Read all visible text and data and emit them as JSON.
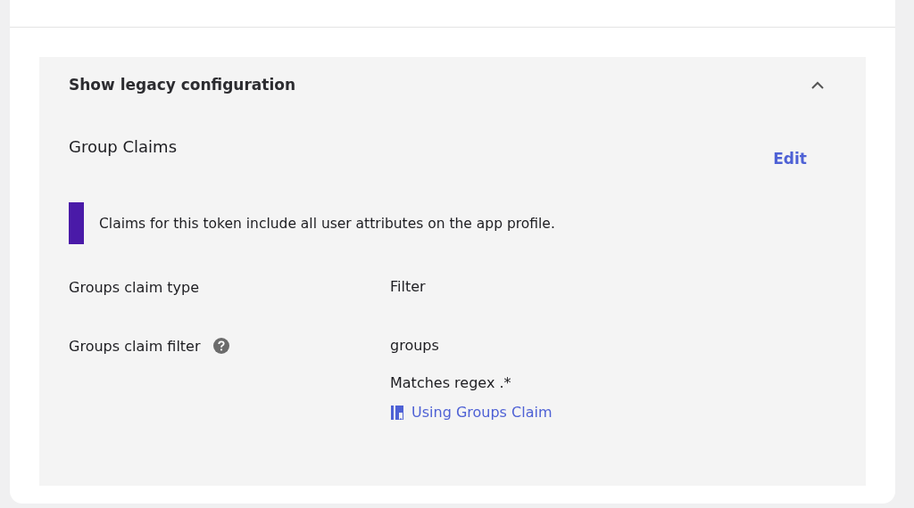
{
  "panel": {
    "title": "Show legacy configuration",
    "expanded": true,
    "section": {
      "title": "Group Claims",
      "edit_label": "Edit"
    },
    "notice": {
      "text": "Claims for this token include all user attributes on the app profile.",
      "color": "#4a1aa8"
    },
    "fields": [
      {
        "label": "Groups claim type",
        "help": false,
        "values": [
          "Filter"
        ]
      },
      {
        "label": "Groups claim filter",
        "help": true,
        "values": [
          "groups",
          "Matches regex .*"
        ],
        "link": "Using Groups Claim"
      }
    ]
  }
}
